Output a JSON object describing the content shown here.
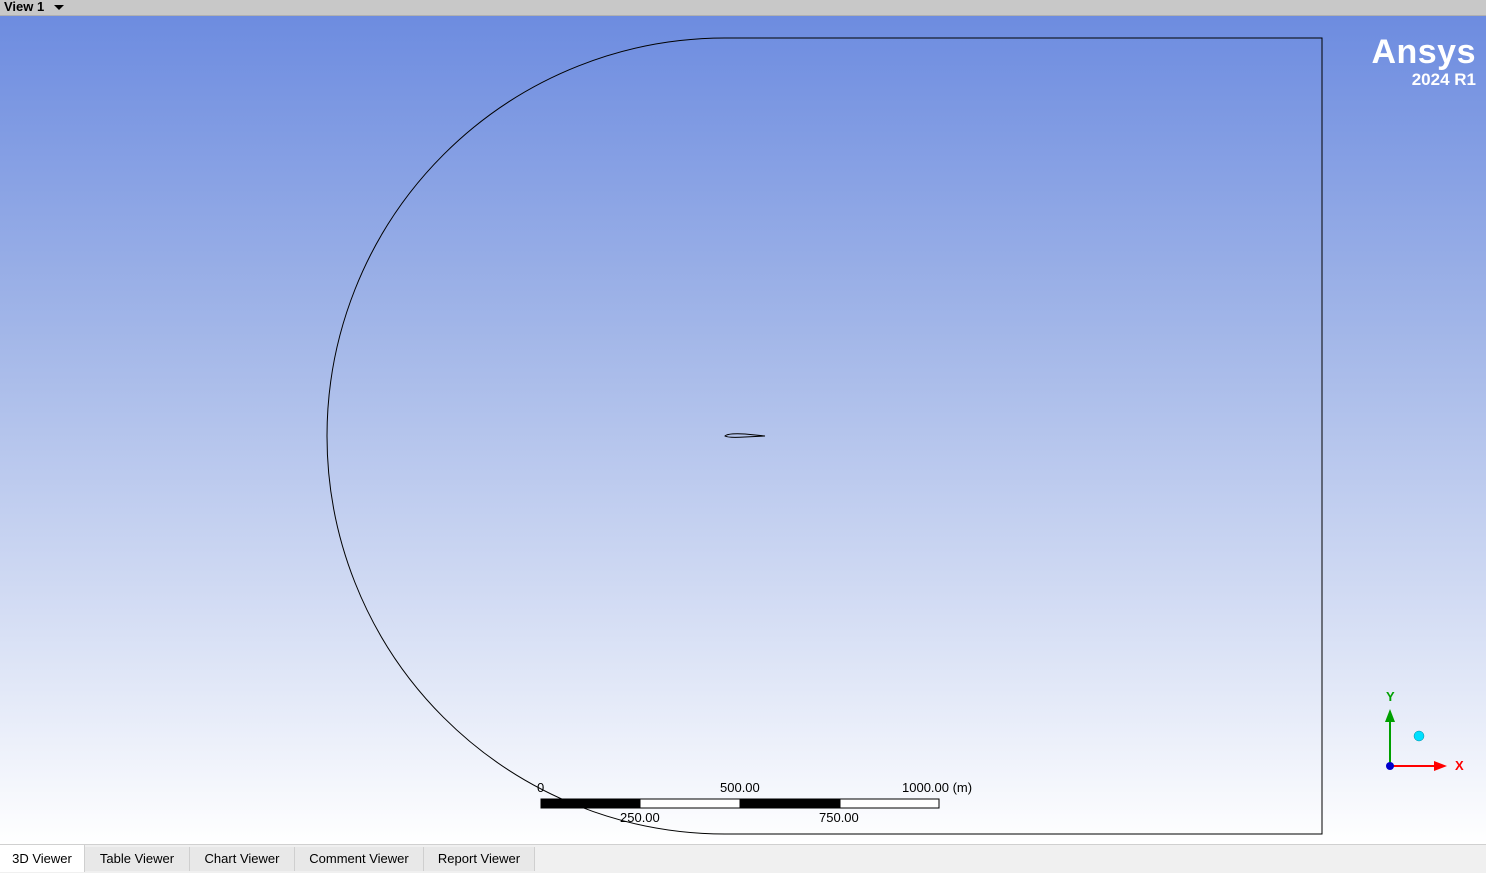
{
  "view": {
    "title": "View 1"
  },
  "logo": {
    "name": "Ansys",
    "version": "2024 R1"
  },
  "scale_bar": {
    "labels_top": [
      "0",
      "500.00",
      "1000.00  (m)"
    ],
    "labels_bottom": [
      "250.00",
      "750.00"
    ]
  },
  "triad": {
    "x_label": "X",
    "y_label": "Y"
  },
  "colors": {
    "background_top": "#6d8ce0",
    "background_bottom": "#ffffff",
    "axis_x": "#ff0000",
    "axis_y": "#00a000",
    "axis_origin": "#0000cc",
    "iso_ball": "#00e0ff"
  },
  "tabs": [
    {
      "label": "3D Viewer",
      "active": true
    },
    {
      "label": "Table Viewer",
      "active": false
    },
    {
      "label": "Chart Viewer",
      "active": false
    },
    {
      "label": "Comment Viewer",
      "active": false
    },
    {
      "label": "Report Viewer",
      "active": false
    }
  ]
}
